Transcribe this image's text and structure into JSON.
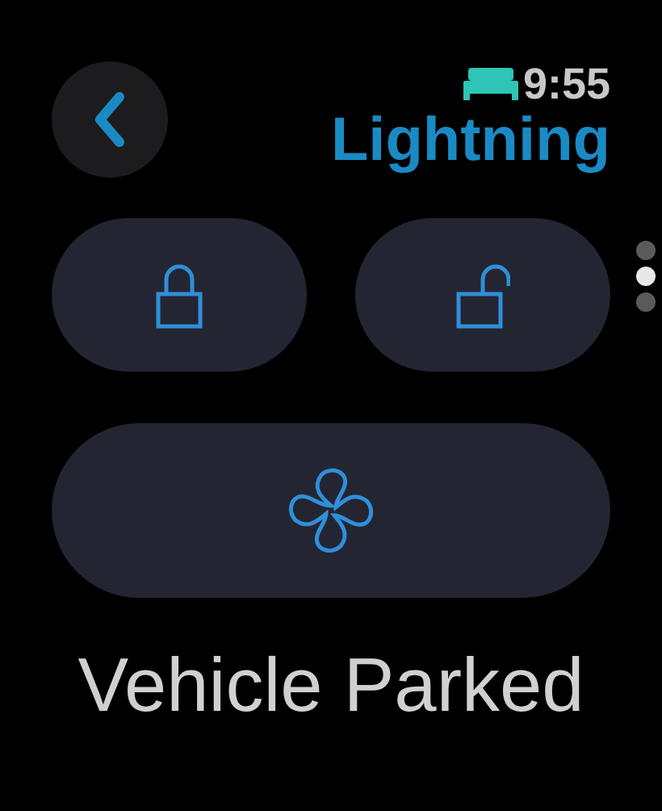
{
  "status": {
    "time": "9:55",
    "sleep_mode": true
  },
  "title": "Lightning",
  "actions": [
    {
      "kind": "lock"
    },
    {
      "kind": "unlock"
    },
    {
      "kind": "fan"
    }
  ],
  "page_dots": [
    {
      "selected": false
    },
    {
      "selected": true
    },
    {
      "selected": false
    }
  ],
  "status_text": "Vehicle Parked"
}
